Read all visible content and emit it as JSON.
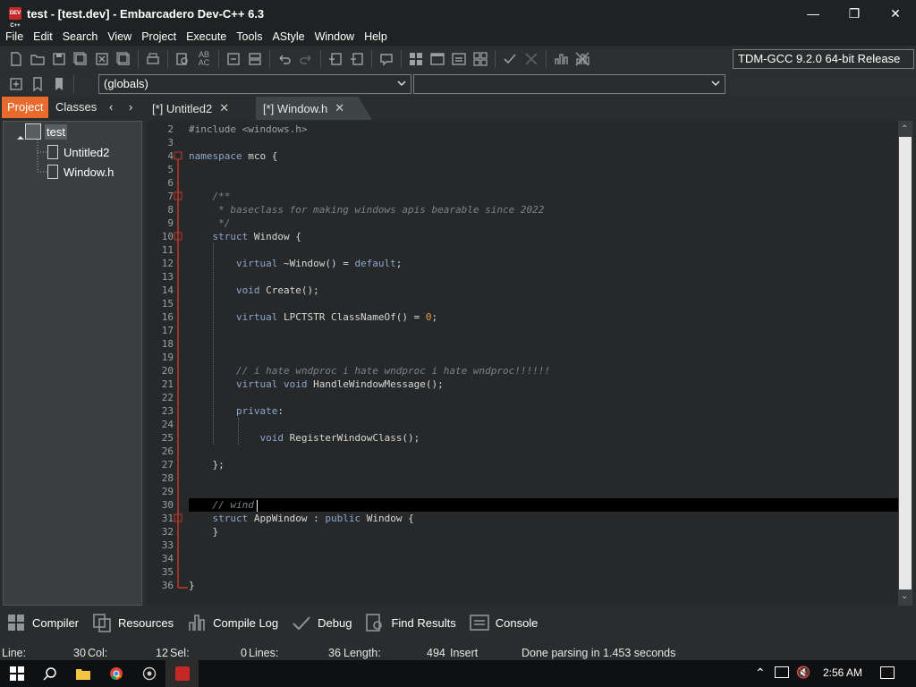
{
  "window": {
    "title": "test - [test.dev] - Embarcadero Dev-C++ 6.3",
    "app_icon_text": "DEV C++"
  },
  "menu": [
    "File",
    "Edit",
    "Search",
    "View",
    "Project",
    "Execute",
    "Tools",
    "AStyle",
    "Window",
    "Help"
  ],
  "toolbar": {
    "compiler": "TDM-GCC 9.2.0 64-bit Release",
    "scope_combo": "(globals)",
    "function_combo": ""
  },
  "left_tabs": {
    "project": "Project",
    "classes": "Classes"
  },
  "editor_tabs": [
    {
      "label": "[*] Untitled2"
    },
    {
      "label": "[*] Window.h"
    }
  ],
  "project_tree": {
    "root": "test",
    "files": [
      "Untitled2",
      "Window.h"
    ]
  },
  "code": {
    "line_numbers": [
      "2",
      "3",
      "4",
      "5",
      "6",
      "7",
      "8",
      "9",
      "10",
      "11",
      "12",
      "13",
      "14",
      "15",
      "16",
      "17",
      "18",
      "19",
      "20",
      "21",
      "22",
      "23",
      "24",
      "25",
      "26",
      "27",
      "28",
      "29",
      "30",
      "31",
      "32",
      "33",
      "34",
      "35",
      "36"
    ],
    "lines": [
      {
        "segs": [
          {
            "t": "#include <windows.h>",
            "c": "cm2"
          }
        ]
      },
      {
        "segs": []
      },
      {
        "segs": [
          {
            "t": "namespace",
            "c": "kw"
          },
          {
            "t": " mco {",
            "c": ""
          }
        ]
      },
      {
        "segs": []
      },
      {
        "segs": []
      },
      {
        "segs": [
          {
            "t": "    /**",
            "c": "cm"
          }
        ]
      },
      {
        "segs": [
          {
            "t": "     * baseclass for making windows apis bearable since 2022",
            "c": "cm"
          }
        ]
      },
      {
        "segs": [
          {
            "t": "     */",
            "c": "cm"
          }
        ]
      },
      {
        "segs": [
          {
            "t": "    ",
            "c": ""
          },
          {
            "t": "struct",
            "c": "kw"
          },
          {
            "t": " Window {",
            "c": ""
          }
        ]
      },
      {
        "segs": []
      },
      {
        "segs": [
          {
            "t": "        ",
            "c": ""
          },
          {
            "t": "virtual",
            "c": "kw"
          },
          {
            "t": " ~Window() = ",
            "c": ""
          },
          {
            "t": "default",
            "c": "kw"
          },
          {
            "t": ";",
            "c": ""
          }
        ]
      },
      {
        "segs": []
      },
      {
        "segs": [
          {
            "t": "        ",
            "c": ""
          },
          {
            "t": "void",
            "c": "kw"
          },
          {
            "t": " Create();",
            "c": ""
          }
        ]
      },
      {
        "segs": []
      },
      {
        "segs": [
          {
            "t": "        ",
            "c": ""
          },
          {
            "t": "virtual",
            "c": "kw"
          },
          {
            "t": " LPCTSTR ClassNameOf() = ",
            "c": ""
          },
          {
            "t": "0",
            "c": "num"
          },
          {
            "t": ";",
            "c": ""
          }
        ]
      },
      {
        "segs": []
      },
      {
        "segs": []
      },
      {
        "segs": []
      },
      {
        "segs": [
          {
            "t": "        // i hate wndproc i hate wndproc i hate wndproc!!!!!!",
            "c": "cm"
          }
        ]
      },
      {
        "segs": [
          {
            "t": "        ",
            "c": ""
          },
          {
            "t": "virtual",
            "c": "kw"
          },
          {
            "t": " ",
            "c": ""
          },
          {
            "t": "void",
            "c": "kw"
          },
          {
            "t": " HandleWindowMessage();",
            "c": ""
          }
        ]
      },
      {
        "segs": []
      },
      {
        "segs": [
          {
            "t": "        ",
            "c": ""
          },
          {
            "t": "private",
            "c": "kw"
          },
          {
            "t": ":",
            "c": ""
          }
        ]
      },
      {
        "segs": []
      },
      {
        "segs": [
          {
            "t": "            ",
            "c": ""
          },
          {
            "t": "void",
            "c": "kw"
          },
          {
            "t": " RegisterWindowClass();",
            "c": ""
          }
        ]
      },
      {
        "segs": []
      },
      {
        "segs": [
          {
            "t": "    };",
            "c": ""
          }
        ]
      },
      {
        "segs": []
      },
      {
        "segs": []
      },
      {
        "segs": [
          {
            "t": "    // wind",
            "c": "cm"
          }
        ]
      },
      {
        "segs": [
          {
            "t": "    ",
            "c": ""
          },
          {
            "t": "struct",
            "c": "kw"
          },
          {
            "t": " AppWindow : ",
            "c": ""
          },
          {
            "t": "public",
            "c": "kw"
          },
          {
            "t": " Window {",
            "c": ""
          }
        ]
      },
      {
        "segs": [
          {
            "t": "    }",
            "c": ""
          }
        ]
      },
      {
        "segs": []
      },
      {
        "segs": []
      },
      {
        "segs": []
      },
      {
        "segs": [
          {
            "t": "}",
            "c": ""
          }
        ]
      }
    ]
  },
  "bottom_tabs": [
    "Compiler",
    "Resources",
    "Compile Log",
    "Debug",
    "Find Results",
    "Console"
  ],
  "status": {
    "line_label": "Line:",
    "line_val": "30",
    "col_label": "Col:",
    "col_val": "12",
    "sel_label": "Sel:",
    "sel_val": "0",
    "lines_label": "Lines:",
    "lines_val": "36",
    "length_label": "Length:",
    "length_val": "494",
    "mode": "Insert",
    "message": "Done parsing in 1.453 seconds"
  },
  "taskbar": {
    "clock": "2:56 AM"
  },
  "colors": {
    "accent": "#e86a2c",
    "keyword": "#8da7cf",
    "comment": "#7c8388"
  }
}
